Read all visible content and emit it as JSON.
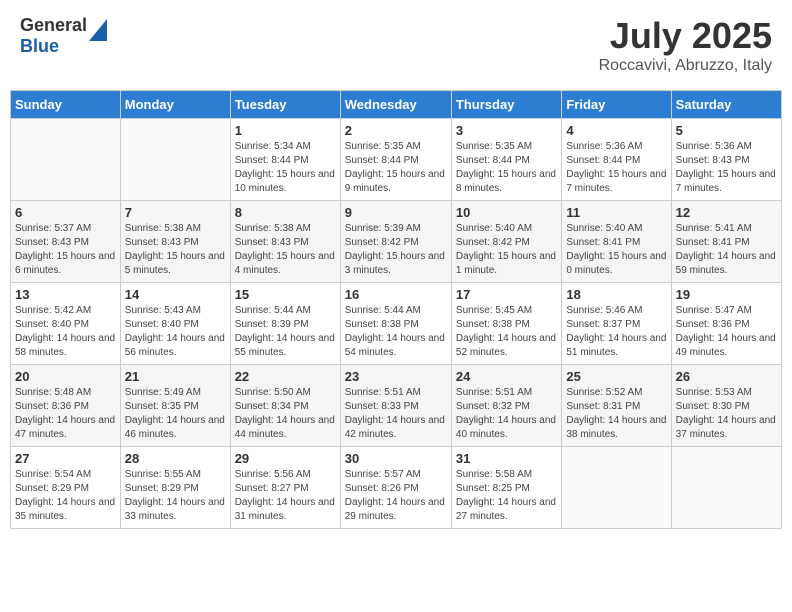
{
  "header": {
    "logo_general": "General",
    "logo_blue": "Blue",
    "month_year": "July 2025",
    "location": "Roccavivi, Abruzzo, Italy"
  },
  "weekdays": [
    "Sunday",
    "Monday",
    "Tuesday",
    "Wednesday",
    "Thursday",
    "Friday",
    "Saturday"
  ],
  "weeks": [
    [
      {
        "day": "",
        "info": ""
      },
      {
        "day": "",
        "info": ""
      },
      {
        "day": "1",
        "info": "Sunrise: 5:34 AM\nSunset: 8:44 PM\nDaylight: 15 hours and 10 minutes."
      },
      {
        "day": "2",
        "info": "Sunrise: 5:35 AM\nSunset: 8:44 PM\nDaylight: 15 hours and 9 minutes."
      },
      {
        "day": "3",
        "info": "Sunrise: 5:35 AM\nSunset: 8:44 PM\nDaylight: 15 hours and 8 minutes."
      },
      {
        "day": "4",
        "info": "Sunrise: 5:36 AM\nSunset: 8:44 PM\nDaylight: 15 hours and 7 minutes."
      },
      {
        "day": "5",
        "info": "Sunrise: 5:36 AM\nSunset: 8:43 PM\nDaylight: 15 hours and 7 minutes."
      }
    ],
    [
      {
        "day": "6",
        "info": "Sunrise: 5:37 AM\nSunset: 8:43 PM\nDaylight: 15 hours and 6 minutes."
      },
      {
        "day": "7",
        "info": "Sunrise: 5:38 AM\nSunset: 8:43 PM\nDaylight: 15 hours and 5 minutes."
      },
      {
        "day": "8",
        "info": "Sunrise: 5:38 AM\nSunset: 8:43 PM\nDaylight: 15 hours and 4 minutes."
      },
      {
        "day": "9",
        "info": "Sunrise: 5:39 AM\nSunset: 8:42 PM\nDaylight: 15 hours and 3 minutes."
      },
      {
        "day": "10",
        "info": "Sunrise: 5:40 AM\nSunset: 8:42 PM\nDaylight: 15 hours and 1 minute."
      },
      {
        "day": "11",
        "info": "Sunrise: 5:40 AM\nSunset: 8:41 PM\nDaylight: 15 hours and 0 minutes."
      },
      {
        "day": "12",
        "info": "Sunrise: 5:41 AM\nSunset: 8:41 PM\nDaylight: 14 hours and 59 minutes."
      }
    ],
    [
      {
        "day": "13",
        "info": "Sunrise: 5:42 AM\nSunset: 8:40 PM\nDaylight: 14 hours and 58 minutes."
      },
      {
        "day": "14",
        "info": "Sunrise: 5:43 AM\nSunset: 8:40 PM\nDaylight: 14 hours and 56 minutes."
      },
      {
        "day": "15",
        "info": "Sunrise: 5:44 AM\nSunset: 8:39 PM\nDaylight: 14 hours and 55 minutes."
      },
      {
        "day": "16",
        "info": "Sunrise: 5:44 AM\nSunset: 8:38 PM\nDaylight: 14 hours and 54 minutes."
      },
      {
        "day": "17",
        "info": "Sunrise: 5:45 AM\nSunset: 8:38 PM\nDaylight: 14 hours and 52 minutes."
      },
      {
        "day": "18",
        "info": "Sunrise: 5:46 AM\nSunset: 8:37 PM\nDaylight: 14 hours and 51 minutes."
      },
      {
        "day": "19",
        "info": "Sunrise: 5:47 AM\nSunset: 8:36 PM\nDaylight: 14 hours and 49 minutes."
      }
    ],
    [
      {
        "day": "20",
        "info": "Sunrise: 5:48 AM\nSunset: 8:36 PM\nDaylight: 14 hours and 47 minutes."
      },
      {
        "day": "21",
        "info": "Sunrise: 5:49 AM\nSunset: 8:35 PM\nDaylight: 14 hours and 46 minutes."
      },
      {
        "day": "22",
        "info": "Sunrise: 5:50 AM\nSunset: 8:34 PM\nDaylight: 14 hours and 44 minutes."
      },
      {
        "day": "23",
        "info": "Sunrise: 5:51 AM\nSunset: 8:33 PM\nDaylight: 14 hours and 42 minutes."
      },
      {
        "day": "24",
        "info": "Sunrise: 5:51 AM\nSunset: 8:32 PM\nDaylight: 14 hours and 40 minutes."
      },
      {
        "day": "25",
        "info": "Sunrise: 5:52 AM\nSunset: 8:31 PM\nDaylight: 14 hours and 38 minutes."
      },
      {
        "day": "26",
        "info": "Sunrise: 5:53 AM\nSunset: 8:30 PM\nDaylight: 14 hours and 37 minutes."
      }
    ],
    [
      {
        "day": "27",
        "info": "Sunrise: 5:54 AM\nSunset: 8:29 PM\nDaylight: 14 hours and 35 minutes."
      },
      {
        "day": "28",
        "info": "Sunrise: 5:55 AM\nSunset: 8:29 PM\nDaylight: 14 hours and 33 minutes."
      },
      {
        "day": "29",
        "info": "Sunrise: 5:56 AM\nSunset: 8:27 PM\nDaylight: 14 hours and 31 minutes."
      },
      {
        "day": "30",
        "info": "Sunrise: 5:57 AM\nSunset: 8:26 PM\nDaylight: 14 hours and 29 minutes."
      },
      {
        "day": "31",
        "info": "Sunrise: 5:58 AM\nSunset: 8:25 PM\nDaylight: 14 hours and 27 minutes."
      },
      {
        "day": "",
        "info": ""
      },
      {
        "day": "",
        "info": ""
      }
    ]
  ]
}
